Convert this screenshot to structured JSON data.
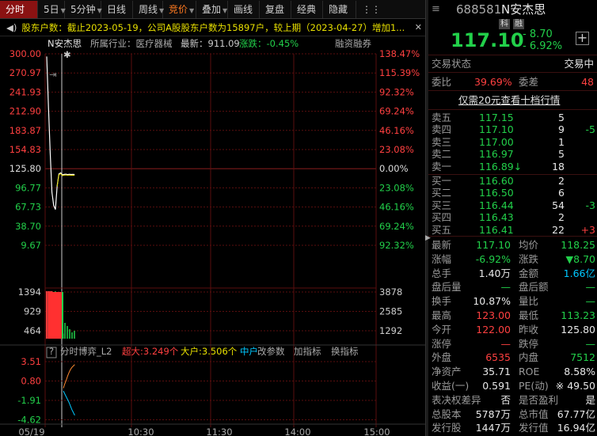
{
  "toolbar": {
    "tabs": [
      "分时",
      "5日",
      "5分钟",
      "日线",
      "周线",
      "竞价",
      "叠加",
      "画线",
      "复盘",
      "经典",
      "隐藏"
    ],
    "active": "分时",
    "dropdown_tabs": [
      "5日",
      "5分钟",
      "周线",
      "竞价",
      "叠加"
    ],
    "more_icon": "more-icon-glyph"
  },
  "notice": {
    "text": "股东户数：截止2023-05-19，公司A股股东户数为15897户，较上期（2023-04-27）增加1...",
    "close": "✕"
  },
  "infobar": {
    "name": "N安杰思",
    "industry": "所属行业：医疗器械",
    "latest": "最新：911.09",
    "change": "涨跌：-0.45%",
    "margin": "融资融券"
  },
  "price_axis": {
    "left": [
      "300.00",
      "270.97",
      "241.93",
      "212.90",
      "183.87",
      "154.83",
      "125.80",
      "96.77",
      "67.73",
      "38.70",
      "9.67"
    ],
    "right": [
      "138.47%",
      "115.39%",
      "92.32%",
      "69.24%",
      "46.16%",
      "23.08%",
      "0.00%",
      "23.08%",
      "46.16%",
      "69.24%",
      "92.32%"
    ],
    "ylim": [
      9.67,
      300.0
    ],
    "prev_close": 125.8
  },
  "volume_axis": {
    "left": [
      "1394",
      "929",
      "464"
    ],
    "right": [
      "3878",
      "2585",
      "1292"
    ]
  },
  "indicator": {
    "help": "?",
    "name": "分时博弈_L2",
    "super": "超大:3.249个",
    "big": "大户:3.506个",
    "mid": "中户",
    "params": "改参数",
    "add": "加指标",
    "swap": "换指标",
    "axis": [
      "3.51",
      "0.80",
      "-1.91",
      "-4.62"
    ]
  },
  "time_axis": [
    "05/19",
    "10:30",
    "11:30",
    "14:00",
    "15:00"
  ],
  "chart_data": {
    "type": "line",
    "series": [
      {
        "values": [
          [
            0,
            296.0
          ],
          [
            0.2,
            220.0
          ],
          [
            0.4,
            150.0
          ],
          [
            0.6,
            90.0
          ],
          [
            0.8,
            70.0
          ],
          [
            1.0,
            64.0
          ],
          [
            1.2,
            100.0
          ],
          [
            1.4,
            118.0
          ],
          [
            1.6,
            119.5
          ],
          [
            1.8,
            116.5
          ],
          [
            2.0,
            117.2
          ],
          [
            2.2,
            117.5
          ],
          [
            2.4,
            117.0
          ],
          [
            2.6,
            117.3
          ],
          [
            2.8,
            117.1
          ],
          [
            3.0,
            117.2
          ],
          [
            3.2,
            117.1
          ]
        ]
      }
    ],
    "volume": [
      1394,
      1394,
      1394,
      1394,
      1394,
      1394,
      900,
      500,
      1394,
      200,
      250,
      200,
      300,
      250,
      200,
      150
    ],
    "indicator": [
      {
        "name": "超大",
        "values": [
          -0.2,
          0.4,
          0.9,
          1.5,
          2.0,
          2.4,
          2.7,
          2.9,
          3.1
        ]
      },
      {
        "name": "大户",
        "values": [
          -0.6,
          -1.0,
          -1.4,
          -1.8,
          -2.2,
          -2.7,
          -3.2,
          -3.6,
          -4.0
        ]
      }
    ]
  },
  "quote": {
    "code": "688581",
    "name": "N安杰思",
    "badge1": "科",
    "badge2": "融",
    "price": "117.10",
    "change": "- 8.70",
    "pct": "- 6.92%",
    "status_label": "交易状态",
    "status": "交易中",
    "wb_label": "委比",
    "wb": "39.69%",
    "wc_label": "委差",
    "wc": "48",
    "promo": "仅需20元查看十档行情"
  },
  "asks": [
    {
      "label": "卖五",
      "price": "117.15",
      "vol": "5",
      "chg": ""
    },
    {
      "label": "卖四",
      "price": "117.10",
      "vol": "9",
      "chg": "-5"
    },
    {
      "label": "卖三",
      "price": "117.00",
      "vol": "1",
      "chg": ""
    },
    {
      "label": "卖二",
      "price": "116.97",
      "vol": "5",
      "chg": ""
    },
    {
      "label": "卖一",
      "price": "116.89↓",
      "vol": "18",
      "chg": ""
    }
  ],
  "bids": [
    {
      "label": "买一",
      "price": "116.60",
      "vol": "2",
      "chg": ""
    },
    {
      "label": "买二",
      "price": "116.50",
      "vol": "6",
      "chg": ""
    },
    {
      "label": "买三",
      "price": "116.44",
      "vol": "54",
      "chg": "-3"
    },
    {
      "label": "买四",
      "price": "116.43",
      "vol": "2",
      "chg": ""
    },
    {
      "label": "买五",
      "price": "116.41",
      "vol": "22",
      "chg": "+3"
    }
  ],
  "stats": [
    {
      "l1": "最新",
      "v1": "117.10",
      "c1": "green",
      "l2": "均价",
      "v2": "118.25",
      "c2": "green"
    },
    {
      "l1": "涨幅",
      "v1": "-6.92%",
      "c1": "green",
      "l2": "涨跌",
      "v2": "▼8.70",
      "c2": "green"
    },
    {
      "l1": "总手",
      "v1": "1.40万",
      "c1": "white",
      "l2": "金额",
      "v2": "1.66亿",
      "c2": "cyan"
    },
    {
      "l1": "盘后量",
      "v1": "—",
      "c1": "green",
      "l2": "盘后额",
      "v2": "—",
      "c2": "green"
    },
    {
      "l1": "换手",
      "v1": "10.87%",
      "c1": "white",
      "l2": "量比",
      "v2": "—",
      "c2": "green"
    },
    {
      "l1": "最高",
      "v1": "123.00",
      "c1": "red",
      "l2": "最低",
      "v2": "113.23",
      "c2": "green"
    },
    {
      "l1": "今开",
      "v1": "122.00",
      "c1": "red",
      "l2": "昨收",
      "v2": "125.80",
      "c2": "white"
    },
    {
      "l1": "涨停",
      "v1": "—",
      "c1": "red",
      "l2": "跌停",
      "v2": "—",
      "c2": "green"
    },
    {
      "l1": "外盘",
      "v1": "6535",
      "c1": "red",
      "l2": "内盘",
      "v2": "7512",
      "c2": "green"
    },
    {
      "l1": "净资产",
      "v1": "35.71",
      "c1": "white",
      "l2": "ROE",
      "v2": "8.58%",
      "c2": "white"
    },
    {
      "l1": "收益(一)",
      "v1": "0.591",
      "c1": "white",
      "l2": "PE(动)",
      "v2": "※ 49.50",
      "c2": "white"
    },
    {
      "l1": "表决权差异",
      "v1": "否",
      "c1": "white",
      "l2": "是否盈利",
      "v2": "是",
      "c2": "white"
    },
    {
      "l1": "总股本",
      "v1": "5787万",
      "c1": "white",
      "l2": "总市值",
      "v2": "67.77亿",
      "c2": "white"
    },
    {
      "l1": "发行股",
      "v1": "1447万",
      "c1": "white",
      "l2": "发行值",
      "v2": "16.94亿",
      "c2": "white"
    }
  ],
  "colors": {
    "up": "#ff4040",
    "down": "#22d04a",
    "accent": "#e8e000",
    "grid": "#5a0e0e"
  }
}
